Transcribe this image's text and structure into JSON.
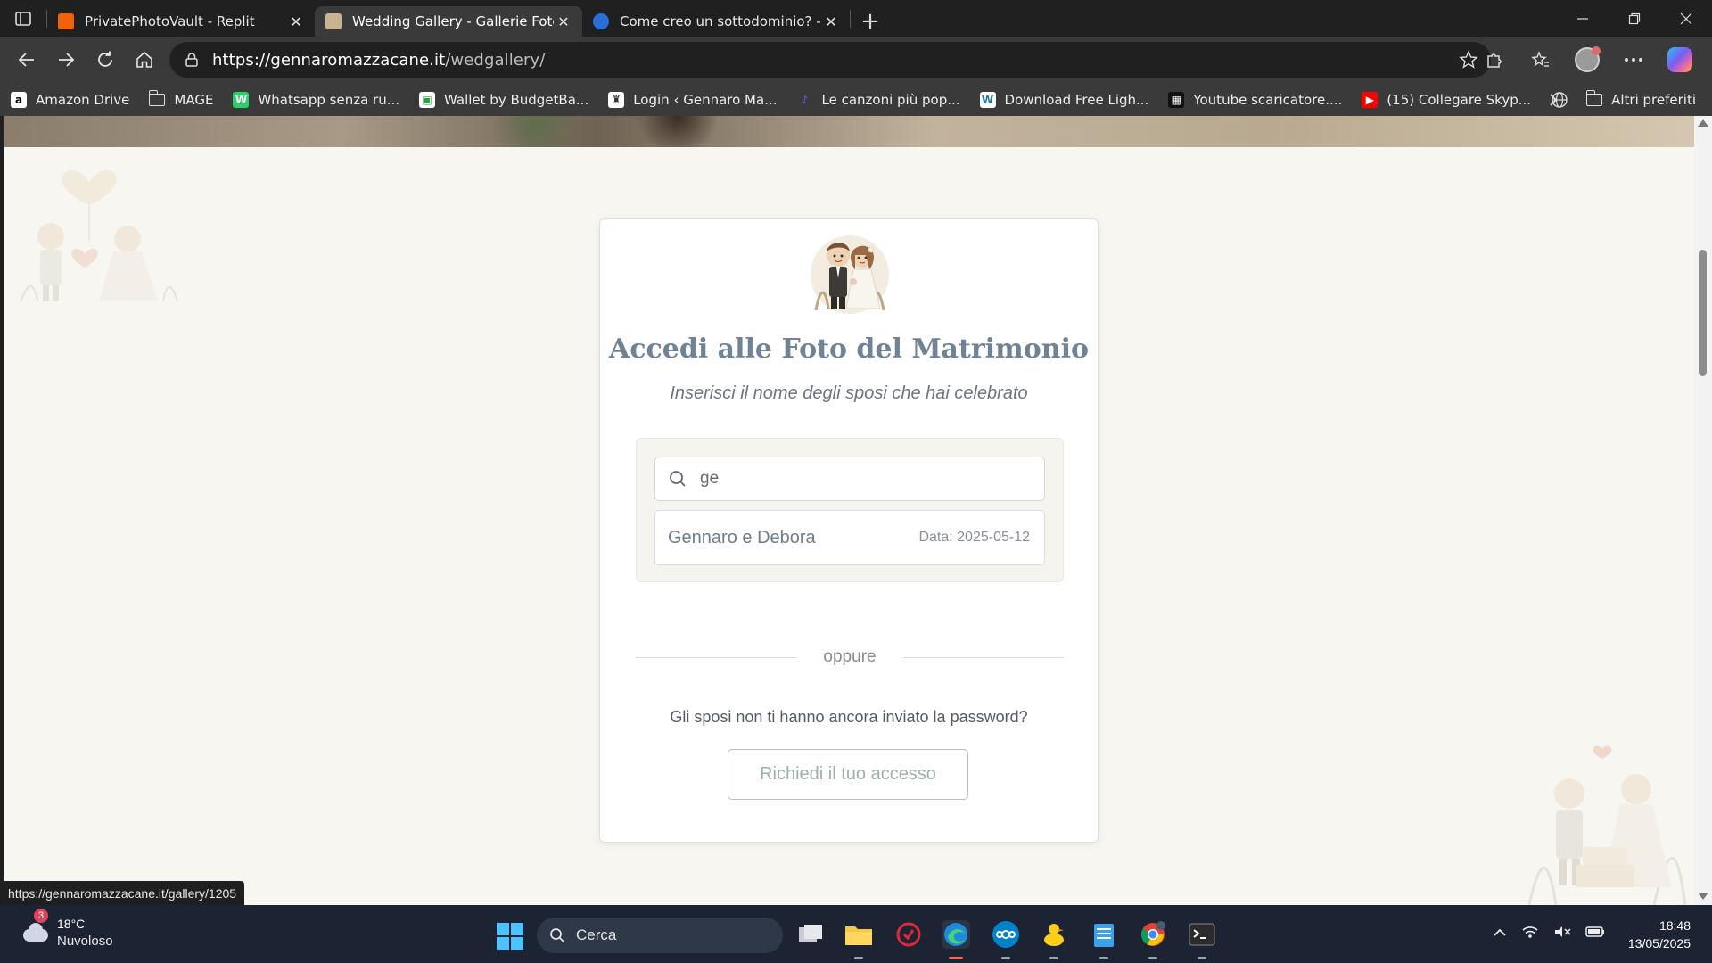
{
  "browser": {
    "tabs": [
      {
        "title": "PrivatePhotoVault - Replit",
        "favicon": "replit-icon",
        "active": false
      },
      {
        "title": "Wedding Gallery - Gallerie Fotogr",
        "favicon": "wedding-photo-icon",
        "active": true
      },
      {
        "title": "Come creo un sottodominio? - Dc",
        "favicon": "help-site-icon",
        "active": false
      }
    ],
    "close_glyph": "✕",
    "new_tab_glyph": "+",
    "url_host": "https://gennaromazzacane.it",
    "url_path": "/wedgallery/",
    "bookmarks": [
      {
        "label": "Amazon Drive",
        "icon": "a",
        "color": "#ffffff",
        "fg": "#000000"
      },
      {
        "label": "MAGE",
        "icon": "folder",
        "color": "",
        "fg": ""
      },
      {
        "label": "Whatsapp senza ru...",
        "icon": "W",
        "color": "#25d366",
        "fg": "#ffffff"
      },
      {
        "label": "Wallet by BudgetBa...",
        "icon": "▣",
        "color": "#ffffff",
        "fg": "#2f9e44"
      },
      {
        "label": "Login ‹ Gennaro Ma...",
        "icon": "♜",
        "color": "#ffffff",
        "fg": "#333333"
      },
      {
        "label": "Le canzoni più pop...",
        "icon": "♪",
        "color": "#3a3a3a",
        "fg": "#7c5cff"
      },
      {
        "label": "Download Free Ligh...",
        "icon": "W",
        "color": "#ffffff",
        "fg": "#21759b"
      },
      {
        "label": "Youtube scaricatore....",
        "icon": "▦",
        "color": "#111111",
        "fg": "#ffffff"
      },
      {
        "label": "(15) Collegare Skyp...",
        "icon": "▶",
        "color": "#ff0000",
        "fg": "#ffffff"
      }
    ],
    "other_bookmarks": "Altri preferiti",
    "status_url": "https://gennaromazzacane.it/gallery/1205"
  },
  "page": {
    "title": "Accedi alle Foto del Matrimonio",
    "subtitle": "Inserisci il nome degli sposi che hai celebrato",
    "search_value": "ge",
    "result": {
      "name": "Gennaro e Debora",
      "date": "Data: 2025-05-12"
    },
    "divider": "oppure",
    "question": "Gli sposi non ti hanno ancora inviato la password?",
    "request_button": "Richiedi il tuo accesso"
  },
  "taskbar": {
    "weather_badge": "3",
    "temperature": "18°C",
    "condition": "Nuvoloso",
    "search_placeholder": "Cerca",
    "time": "18:48",
    "date": "13/05/2025"
  },
  "colors": {
    "title": "#6f8296",
    "page_bg": "#f7f6f1",
    "button_text": "#9fb0a6",
    "taskbar": "#1c2433"
  }
}
